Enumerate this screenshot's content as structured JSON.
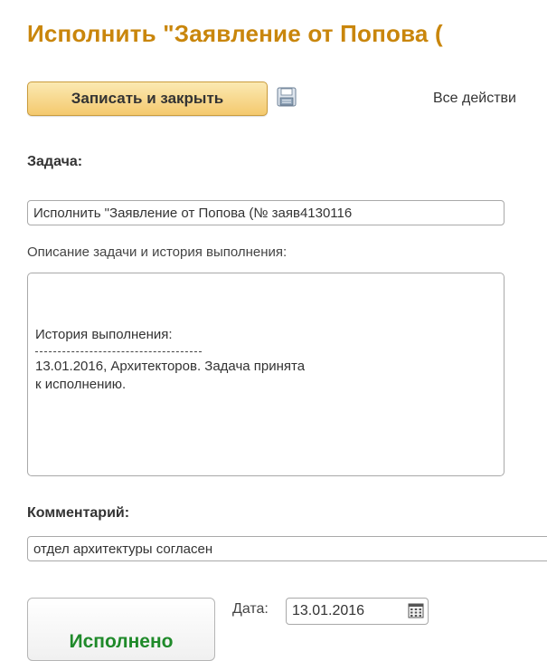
{
  "header": {
    "title": "Исполнить \"Заявление от Попова (",
    "all_actions": "Все действи"
  },
  "toolbar": {
    "save_close_label": "Записать и закрыть",
    "save_icon": "floppy-disk-icon"
  },
  "task": {
    "label": "Задача:",
    "value": "Исполнить \"Заявление от Попова (№ заяв4130116"
  },
  "description": {
    "label": "Описание задачи и история выполнения:",
    "history_title": "История выполнения:",
    "history_text": "13.01.2016, Архитекторов. Задача принята к исполнению."
  },
  "comment": {
    "label": "Комментарий:",
    "value": "отдел архитектуры согласен"
  },
  "completion": {
    "done_label": "Исполнено",
    "date_label": "Дата:",
    "date_value": "13.01.2016",
    "calendar_icon": "calendar-icon"
  },
  "colors": {
    "title": "#c9860c",
    "primary_button": "#f4c96e",
    "done_text": "#1f8a2a"
  }
}
